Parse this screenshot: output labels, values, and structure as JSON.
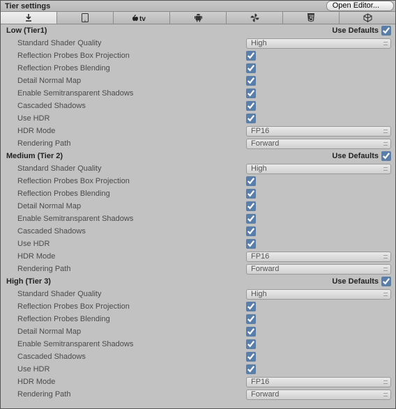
{
  "header": {
    "title": "Tier settings",
    "open_editor_label": "Open Editor..."
  },
  "tabs": [
    {
      "name": "download-icon",
      "selected": true
    },
    {
      "name": "tablet-icon",
      "selected": false
    },
    {
      "name": "appletv-icon",
      "selected": false
    },
    {
      "name": "android-icon",
      "selected": false
    },
    {
      "name": "pinwheel-icon",
      "selected": false
    },
    {
      "name": "html5-icon",
      "selected": false
    },
    {
      "name": "cube-icon",
      "selected": false
    }
  ],
  "labels": {
    "use_defaults": "Use Defaults",
    "standard_shader_quality": "Standard Shader Quality",
    "reflection_probes_box_projection": "Reflection Probes Box Projection",
    "reflection_probes_blending": "Reflection Probes Blending",
    "detail_normal_map": "Detail Normal Map",
    "enable_semitransparent_shadows": "Enable Semitransparent Shadows",
    "cascaded_shadows": "Cascaded Shadows",
    "use_hdr": "Use HDR",
    "hdr_mode": "HDR Mode",
    "rendering_path": "Rendering Path"
  },
  "tiers": [
    {
      "title": "Low (Tier1)",
      "use_defaults": true,
      "standard_shader_quality": "High",
      "reflection_probes_box_projection": true,
      "reflection_probes_blending": true,
      "detail_normal_map": true,
      "enable_semitransparent_shadows": true,
      "cascaded_shadows": true,
      "use_hdr": true,
      "hdr_mode": "FP16",
      "rendering_path": "Forward"
    },
    {
      "title": "Medium (Tier 2)",
      "use_defaults": true,
      "standard_shader_quality": "High",
      "reflection_probes_box_projection": true,
      "reflection_probes_blending": true,
      "detail_normal_map": true,
      "enable_semitransparent_shadows": true,
      "cascaded_shadows": true,
      "use_hdr": true,
      "hdr_mode": "FP16",
      "rendering_path": "Forward"
    },
    {
      "title": "High (Tier 3)",
      "use_defaults": true,
      "standard_shader_quality": "High",
      "reflection_probes_box_projection": true,
      "reflection_probes_blending": true,
      "detail_normal_map": true,
      "enable_semitransparent_shadows": true,
      "cascaded_shadows": true,
      "use_hdr": true,
      "hdr_mode": "FP16",
      "rendering_path": "Forward"
    }
  ]
}
